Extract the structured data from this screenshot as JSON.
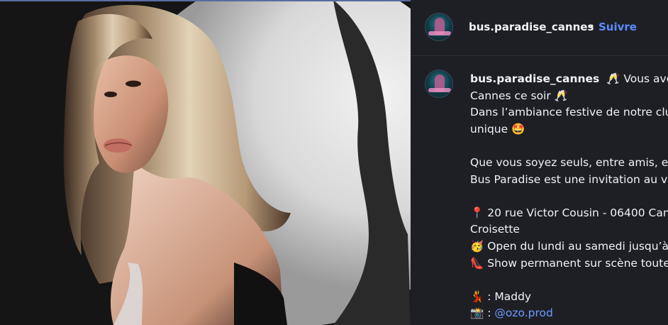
{
  "post": {
    "username": "bus.paradise_cannes",
    "separator": "•",
    "follow_label": "Suivre",
    "caption_lines": [
      "🥂 Vous avez r",
      "Cannes ce soir 🥂",
      "Dans l’ambiance festive de notre clu",
      "unique 🤩",
      "",
      "Que vous soyez seuls, entre amis, en",
      "Bus Paradise est une invitation au vo",
      "",
      "📍 20 rue Victor Cousin - 06400 Can",
      "Croisette",
      "🥳 Open du lundi au samedi jusqu’à",
      "👠 Show permanent sur scène toute",
      "",
      "💃 : Maddy",
      "📸 : "
    ],
    "mention": "@ozo.prod"
  },
  "colors": {
    "panel_bg": "#1e1f25",
    "follow": "#5b8cff",
    "mention": "#6e9bff"
  }
}
